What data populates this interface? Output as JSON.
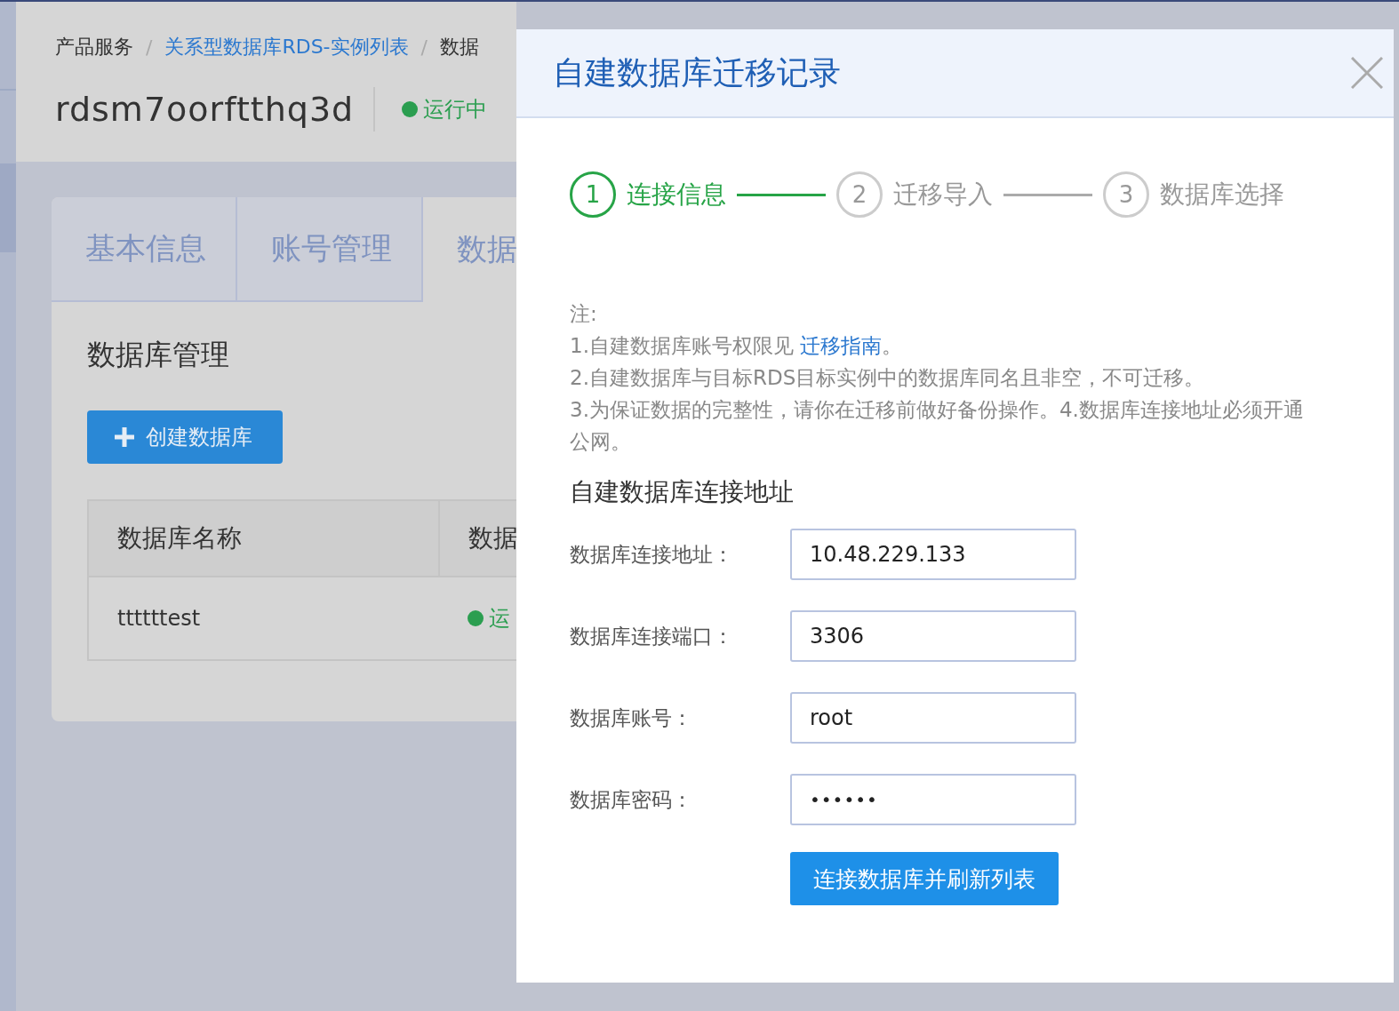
{
  "background_page": {
    "breadcrumb_separator": "/",
    "breadcrumb": [
      {
        "label": "产品服务",
        "kind": "plain"
      },
      {
        "label": "关系型数据库RDS-实例列表",
        "kind": "link"
      },
      {
        "label": "数据",
        "kind": "plain"
      }
    ],
    "instance": {
      "name": "rdsm7oorftthq3d",
      "status": "运行中"
    },
    "tabs": [
      {
        "label": "基本信息",
        "selected": false
      },
      {
        "label": "账号管理",
        "selected": false
      },
      {
        "label": "数据",
        "selected": true
      }
    ],
    "section_title": "数据库管理",
    "create_button": "创建数据库",
    "table": {
      "columns": [
        "数据库名称",
        "数据"
      ],
      "rows": [
        {
          "name": "ttttttest",
          "status": "运"
        }
      ]
    }
  },
  "dialog": {
    "title": "自建数据库迁移记录",
    "steps": [
      {
        "number": "1",
        "label": "连接信息",
        "selected": true
      },
      {
        "number": "2",
        "label": "迁移导入",
        "selected": false
      },
      {
        "number": "3",
        "label": "数据库选择",
        "selected": false
      }
    ],
    "notes": {
      "title": "注:",
      "line_1": {
        "text": "1.自建数据库账号权限见",
        "link": "迁移指南",
        "suffix": "。"
      },
      "line_2": "2.自建数据库与目标RDS目标实例中的数据库同名且非空，不可迁移。",
      "line_3": "3.为保证数据的完整性，请你在迁移前做好备份操作。4.数据库连接地址必须开通公网。"
    },
    "form_title": "自建数据库连接地址",
    "fields": [
      {
        "label": "数据库连接地址：",
        "value": "10.48.229.133",
        "kind": "text"
      },
      {
        "label": "数据库连接端口：",
        "value": "3306",
        "kind": "text"
      },
      {
        "label": "数据库账号：",
        "value": "root",
        "kind": "text"
      },
      {
        "label": "数据库密码：",
        "value": "••••••",
        "kind": "password"
      }
    ],
    "submit_button": "连接数据库并刷新列表"
  }
}
